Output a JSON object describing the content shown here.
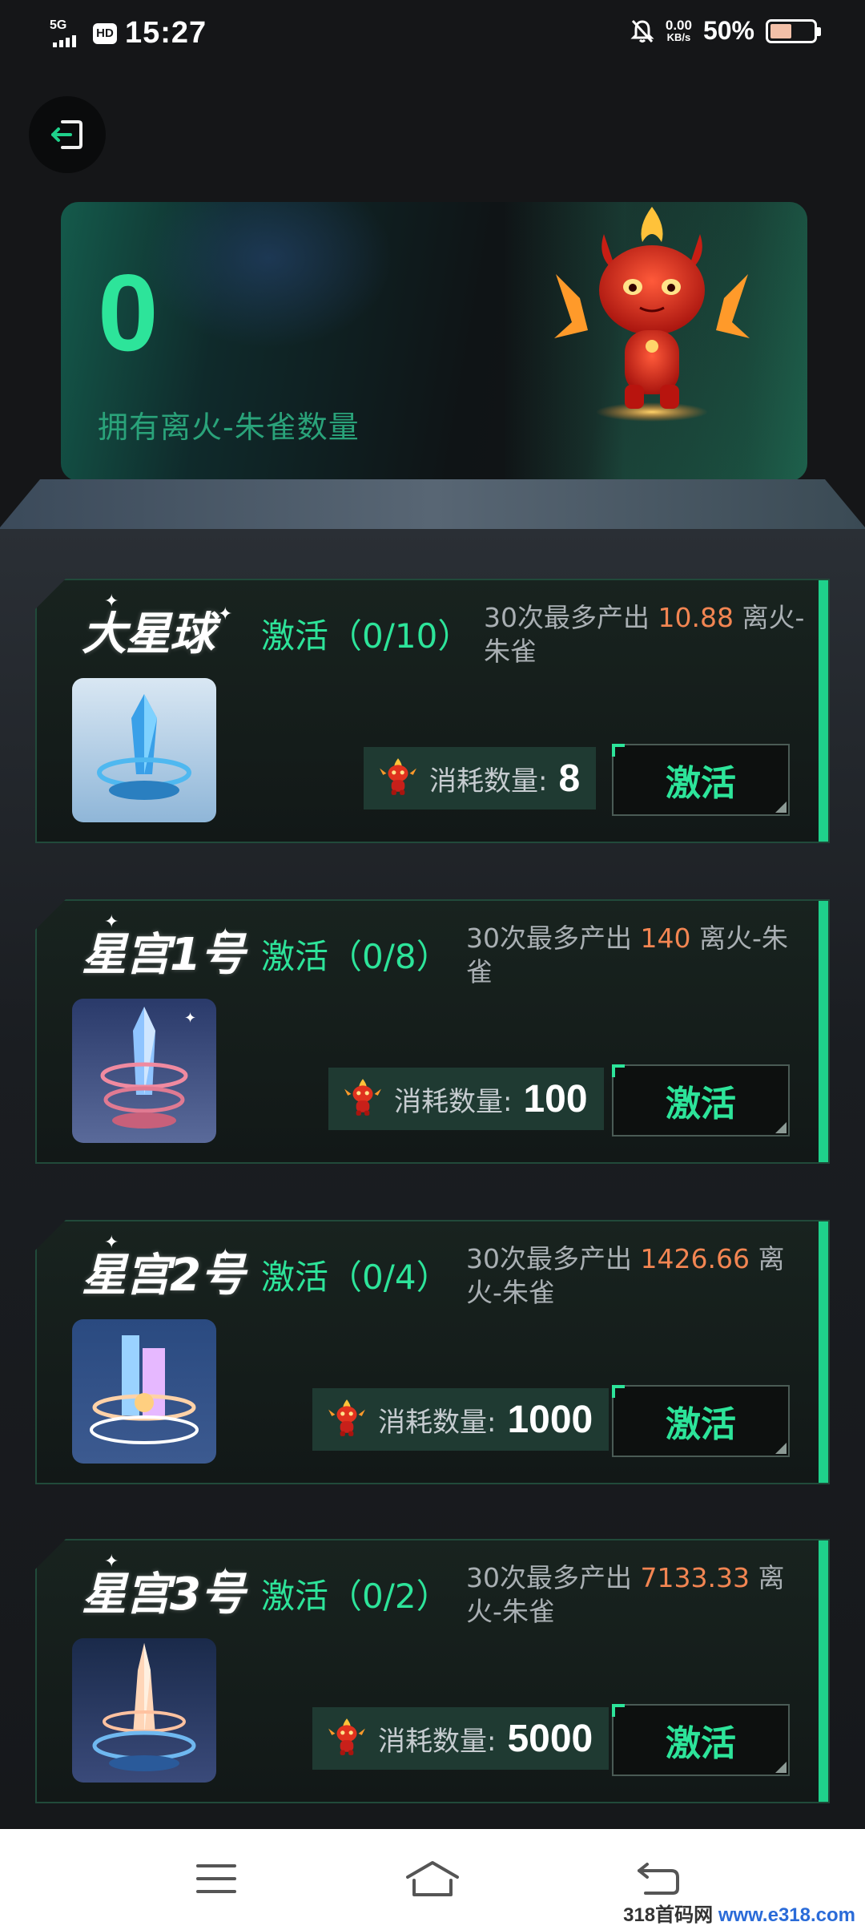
{
  "status_bar": {
    "network": "5G",
    "hd": "HD",
    "time": "15:27",
    "net_speed_value": "0.00",
    "net_speed_unit": "KB/s",
    "battery_percent": "50%",
    "battery_level": 0.5,
    "icons": [
      "signal-icon",
      "hd-icon",
      "mute-icon",
      "battery-icon"
    ]
  },
  "header": {
    "back_icon": "exit-icon"
  },
  "hero": {
    "count": "0",
    "label": "拥有离火-朱雀数量",
    "accent": "#2de49a"
  },
  "cards": [
    {
      "title": "大星球",
      "status": "激活（0/10）",
      "desc_prefix": "30次最多产出 ",
      "amount": "10.88",
      "desc_suffix": " 离火-朱雀",
      "cost_label": "消耗数量:",
      "cost_value": "8",
      "button": "激活"
    },
    {
      "title": "星宫1号",
      "status": "激活（0/8）",
      "desc_prefix": "30次最多产出 ",
      "amount": "140",
      "desc_suffix": " 离火-朱雀",
      "cost_label": "消耗数量:",
      "cost_value": "100",
      "button": "激活"
    },
    {
      "title": "星宫2号",
      "status": "激活（0/4）",
      "desc_prefix": "30次最多产出 ",
      "amount": "1426.66",
      "desc_suffix": " 离火-朱雀",
      "cost_label": "消耗数量:",
      "cost_value": "1000",
      "button": "激活"
    },
    {
      "title": "星宫3号",
      "status": "激活（0/2）",
      "desc_prefix": "30次最多产出 ",
      "amount": "7133.33",
      "desc_suffix": " 离火-朱雀",
      "cost_label": "消耗数量:",
      "cost_value": "5000",
      "button": "激活"
    }
  ],
  "nav": {
    "icons": [
      "menu-icon",
      "home-icon",
      "back-icon"
    ]
  },
  "watermark": {
    "prefix": "318首码网 ",
    "site": "www.e318.com"
  },
  "colors": {
    "accent_green": "#2de49a",
    "amount_orange": "#f28552",
    "background": "#151618"
  }
}
